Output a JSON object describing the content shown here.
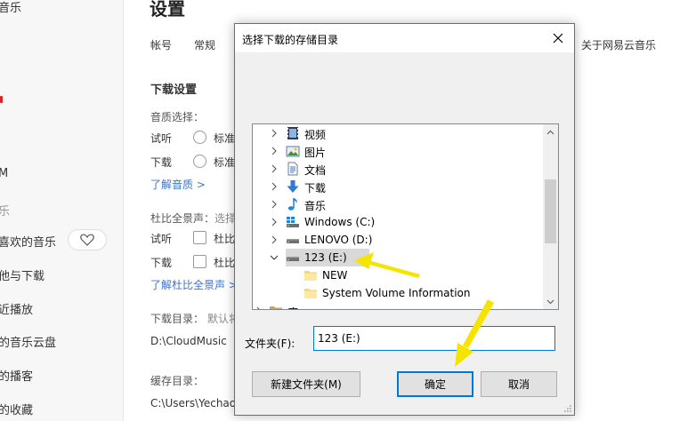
{
  "sidebar": {
    "items": [
      "音乐",
      "M",
      "乐",
      "喜欢的音乐",
      "他与下载",
      "近播放",
      "的音乐云盘",
      "的播客",
      "的收藏"
    ]
  },
  "settings": {
    "title": "设置",
    "tabs": [
      "帐号",
      "常规",
      "关于网易云音乐"
    ],
    "download_section": "下载设置",
    "quality_label": "音质选择：",
    "listen": "试听",
    "download": "下载",
    "standard": "标准",
    "learn_quality": "了解音质 >",
    "dolby_label": "杜比全景声：",
    "dolby_hint": "选择",
    "dolby_short": "杜比",
    "learn_dolby": "了解杜比全景声 >",
    "dir_label": "下载目录：",
    "dir_hint": "默认将",
    "dir_value": "D:\\CloudMusic",
    "cache_label": "缓存目录：",
    "cache_value": "C:\\Users\\Yechao\\"
  },
  "dialog": {
    "title": "选择下载的存储目录",
    "tree": [
      {
        "label": "视频",
        "icon": "video-icon"
      },
      {
        "label": "图片",
        "icon": "picture-icon"
      },
      {
        "label": "文档",
        "icon": "document-icon"
      },
      {
        "label": "下载",
        "icon": "download-icon"
      },
      {
        "label": "音乐",
        "icon": "music-icon"
      },
      {
        "label": "Windows (C:)",
        "icon": "drive-icon"
      },
      {
        "label": "LENOVO (D:)",
        "icon": "drive-icon"
      },
      {
        "label": "123 (E:)",
        "icon": "drive-icon"
      },
      {
        "label": "NEW",
        "icon": "folder-icon"
      },
      {
        "label": "System Volume Information",
        "icon": "folder-icon"
      },
      {
        "label": "库",
        "icon": "library-icon"
      }
    ],
    "folder_label": "文件夹(F):",
    "folder_value": "123 (E:)",
    "new_folder": "新建文件夹(M)",
    "ok": "确定",
    "cancel": "取消"
  },
  "colors": {
    "accent": "#0078d7",
    "link": "#3c74c9",
    "arrow": "#f5e400",
    "selection": "#d9d9d9"
  }
}
